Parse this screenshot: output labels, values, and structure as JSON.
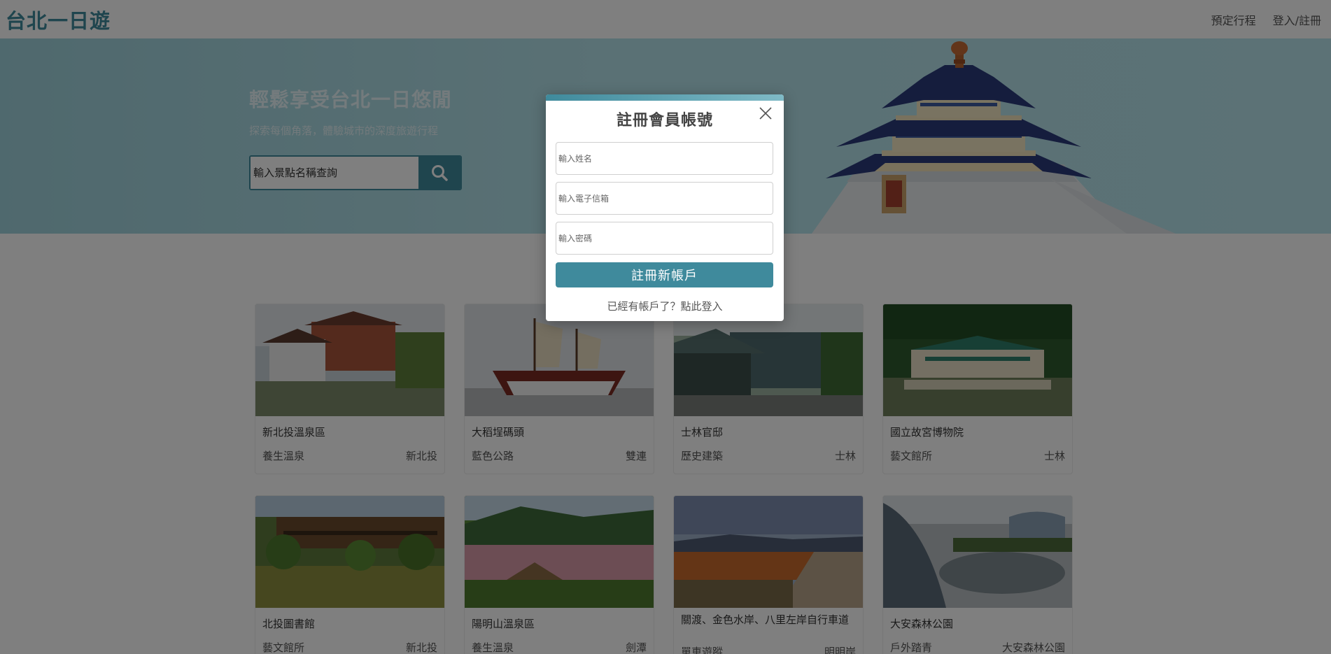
{
  "navbar": {
    "brand": "台北一日遊",
    "links": [
      "預定行程",
      "登入/註冊"
    ]
  },
  "hero": {
    "title": "輕鬆享受台北一日悠閒",
    "subtitle": "探索每個角落，體驗城市的深度旅遊行程",
    "search_placeholder": "輸入景點名稱查詢",
    "search_icon": "search-icon"
  },
  "attractions": [
    {
      "name": "新北投溫泉區",
      "category": "養生溫泉",
      "mrt": "新北投"
    },
    {
      "name": "大稻埕碼頭",
      "category": "藍色公路",
      "mrt": "雙連"
    },
    {
      "name": "士林官邸",
      "category": "歷史建築",
      "mrt": "士林"
    },
    {
      "name": "國立故宮博物院",
      "category": "藝文館所",
      "mrt": "士林"
    },
    {
      "name": "北投圖書館",
      "category": "藝文館所",
      "mrt": "新北投"
    },
    {
      "name": "陽明山溫泉區",
      "category": "養生溫泉",
      "mrt": "劍潭"
    },
    {
      "name": "關渡、金色水岸、八里左岸自行車道",
      "category": "單車遊蹤",
      "mrt": "明明岸"
    },
    {
      "name": "大安森林公園",
      "category": "戶外踏青",
      "mrt": "大安森林公園"
    }
  ],
  "modal": {
    "title": "註冊會員帳號",
    "name_placeholder": "輸入姓名",
    "email_placeholder": "輸入電子信箱",
    "password_placeholder": "輸入密碼",
    "submit_label": "註冊新帳戶",
    "login_link": "已經有帳戶了？點此登入",
    "close_icon": "close-icon"
  },
  "colors": {
    "accent": "#3f8a9c",
    "hero_bg": "#b4e2ea",
    "overlay": "rgba(0,0,0,0.5)"
  }
}
